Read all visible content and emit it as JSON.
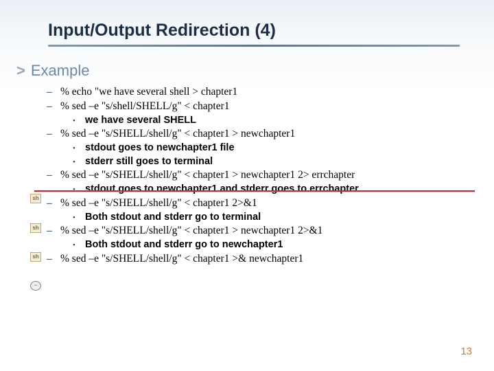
{
  "title": "Input/Output Redirection (4)",
  "subtitle_marker": ">",
  "subtitle": "Example",
  "items": [
    {
      "cmd": "% echo \"we have several shell > chapter1"
    },
    {
      "cmd": "% sed –e \"s/shell/SHELL/g\"  <  chapter1",
      "subs": [
        "we have several SHELL"
      ]
    },
    {
      "cmd": "% sed –e \"s/SHELL/shell/g\"  <  chapter1 > newchapter1",
      "subs": [
        "stdout goes to newchapter1 file",
        "stderr still goes to terminal"
      ]
    },
    {
      "cmd": "% sed –e \"s/SHELL/shell/g\" < chapter1 > newchapter1 2> errchapter",
      "subs": [
        "stdout goes to newchapter1 and stderr goes to errchapter"
      ],
      "icon": "sh"
    },
    {
      "cmd": "% sed –e \"s/SHELL/shell/g\" < chapter1 2>&1",
      "subs": [
        "Both stdout and stderr go to terminal"
      ],
      "icon": "sh"
    },
    {
      "cmd": "% sed –e \"s/SHELL/shell/g\" < chapter1 > newchapter1 2>&1",
      "subs": [
        "Both stdout and stderr go to newchapter1"
      ],
      "icon": "sh"
    },
    {
      "cmd": "% sed –e \"s/SHELL/shell/g\" < chapter1 >& newchapter1",
      "icon": "csh"
    }
  ],
  "icon_labels": {
    "sh": "sh",
    "csh": "~"
  },
  "page_number": "13"
}
